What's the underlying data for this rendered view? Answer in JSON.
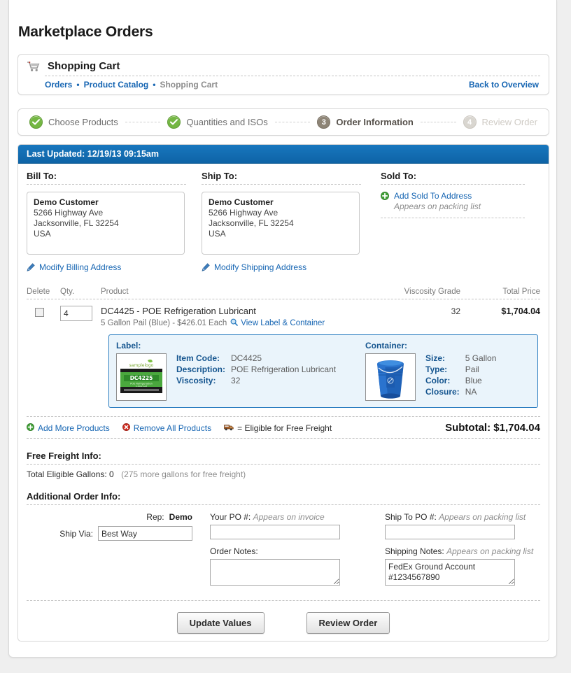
{
  "page_title": "Marketplace Orders",
  "cart": {
    "icon": "shopping-cart-icon",
    "title": "Shopping Cart",
    "breadcrumbs": [
      {
        "label": "Orders",
        "current": false
      },
      {
        "label": "Product Catalog",
        "current": false
      },
      {
        "label": "Shopping Cart",
        "current": true
      }
    ],
    "separator": "•",
    "back_link": "Back to Overview"
  },
  "steps": [
    {
      "num": "1",
      "label": "Choose Products",
      "state": "done",
      "glyph": "check-icon"
    },
    {
      "num": "2",
      "label": "Quantities and ISOs",
      "state": "done",
      "glyph": "check-icon"
    },
    {
      "num": "3",
      "label": "Order Information",
      "state": "active",
      "glyph": "3"
    },
    {
      "num": "4",
      "label": "Review Order",
      "state": "todo",
      "glyph": "4"
    }
  ],
  "last_updated": "Last Updated: 12/19/13 09:15am",
  "addresses": {
    "bill": {
      "heading": "Bill To:",
      "name": "Demo Customer",
      "line1": "5266 Highway Ave",
      "line2": "Jacksonville, FL 32254",
      "line3": "USA",
      "edit_label": "Modify Billing Address"
    },
    "ship": {
      "heading": "Ship To:",
      "name": "Demo Customer",
      "line1": "5266 Highway Ave",
      "line2": "Jacksonville, FL 32254",
      "line3": "USA",
      "edit_label": "Modify Shipping Address"
    },
    "sold": {
      "heading": "Sold To:",
      "add_label": "Add Sold To Address",
      "hint": "Appears on packing list"
    }
  },
  "product_table": {
    "columns": {
      "delete": "Delete",
      "qty": "Qty.",
      "product": "Product",
      "viscosity": "Viscosity Grade",
      "total_price": "Total Price"
    },
    "rows": [
      {
        "qty": "4",
        "name": "DC4425 - POE Refrigeration Lubricant",
        "sub": "5 Gallon Pail (Blue) - $426.01 Each",
        "view_link": "View Label & Container",
        "viscosity": "32",
        "total_price": "$1,704.04"
      }
    ]
  },
  "detail": {
    "label_heading": "Label:",
    "label_image_text": "DC4225",
    "label_image_sub1": "POE Refrigeration",
    "label_image_sub2": "Lubricant",
    "label_image_brand": "samplelogo",
    "label_fields": [
      {
        "k": "Item Code:",
        "v": "DC4425"
      },
      {
        "k": "Description:",
        "v": "POE Refrigeration Lubricant"
      },
      {
        "k": "Viscosity:",
        "v": "32"
      }
    ],
    "container_heading": "Container:",
    "container_fields": [
      {
        "k": "Size:",
        "v": "5 Gallon"
      },
      {
        "k": "Type:",
        "v": "Pail"
      },
      {
        "k": "Color:",
        "v": "Blue"
      },
      {
        "k": "Closure:",
        "v": "NA"
      }
    ]
  },
  "actions": {
    "add_more": "Add More Products",
    "remove_all": "Remove All Products",
    "freight_legend": "= Eligible for Free Freight",
    "subtotal_label": "Subtotal:",
    "subtotal_value": "$1,704.04"
  },
  "free_freight": {
    "heading": "Free Freight Info:",
    "gallons_label": "Total Eligible Gallons: 0",
    "gallons_hint": "(275 more gallons for free freight)"
  },
  "additional_info": {
    "heading": "Additional Order Info:",
    "rep_label": "Rep:",
    "rep_value": "Demo",
    "ship_via_label": "Ship Via:",
    "ship_via_value": "Best Way",
    "your_po_label": "Your PO #:",
    "your_po_hint": "Appears on invoice",
    "your_po_value": "",
    "order_notes_label": "Order Notes:",
    "order_notes_value": "",
    "ship_to_po_label": "Ship To PO #:",
    "ship_to_po_hint": "Appears on packing list",
    "ship_to_po_value": "",
    "shipping_notes_label": "Shipping Notes:",
    "shipping_notes_hint": "Appears on packing list",
    "shipping_notes_value": "FedEx Ground Account #1234567890"
  },
  "buttons": {
    "update": "Update Values",
    "review": "Review Order"
  },
  "colors": {
    "link": "#1766b3",
    "blue_bar": "#1070b6",
    "step_done": "#74b743",
    "step_active": "#8d8476",
    "step_todo": "#d9d6d0",
    "detail_border": "#2b7dc0",
    "detail_bg": "#eaf4fb"
  }
}
